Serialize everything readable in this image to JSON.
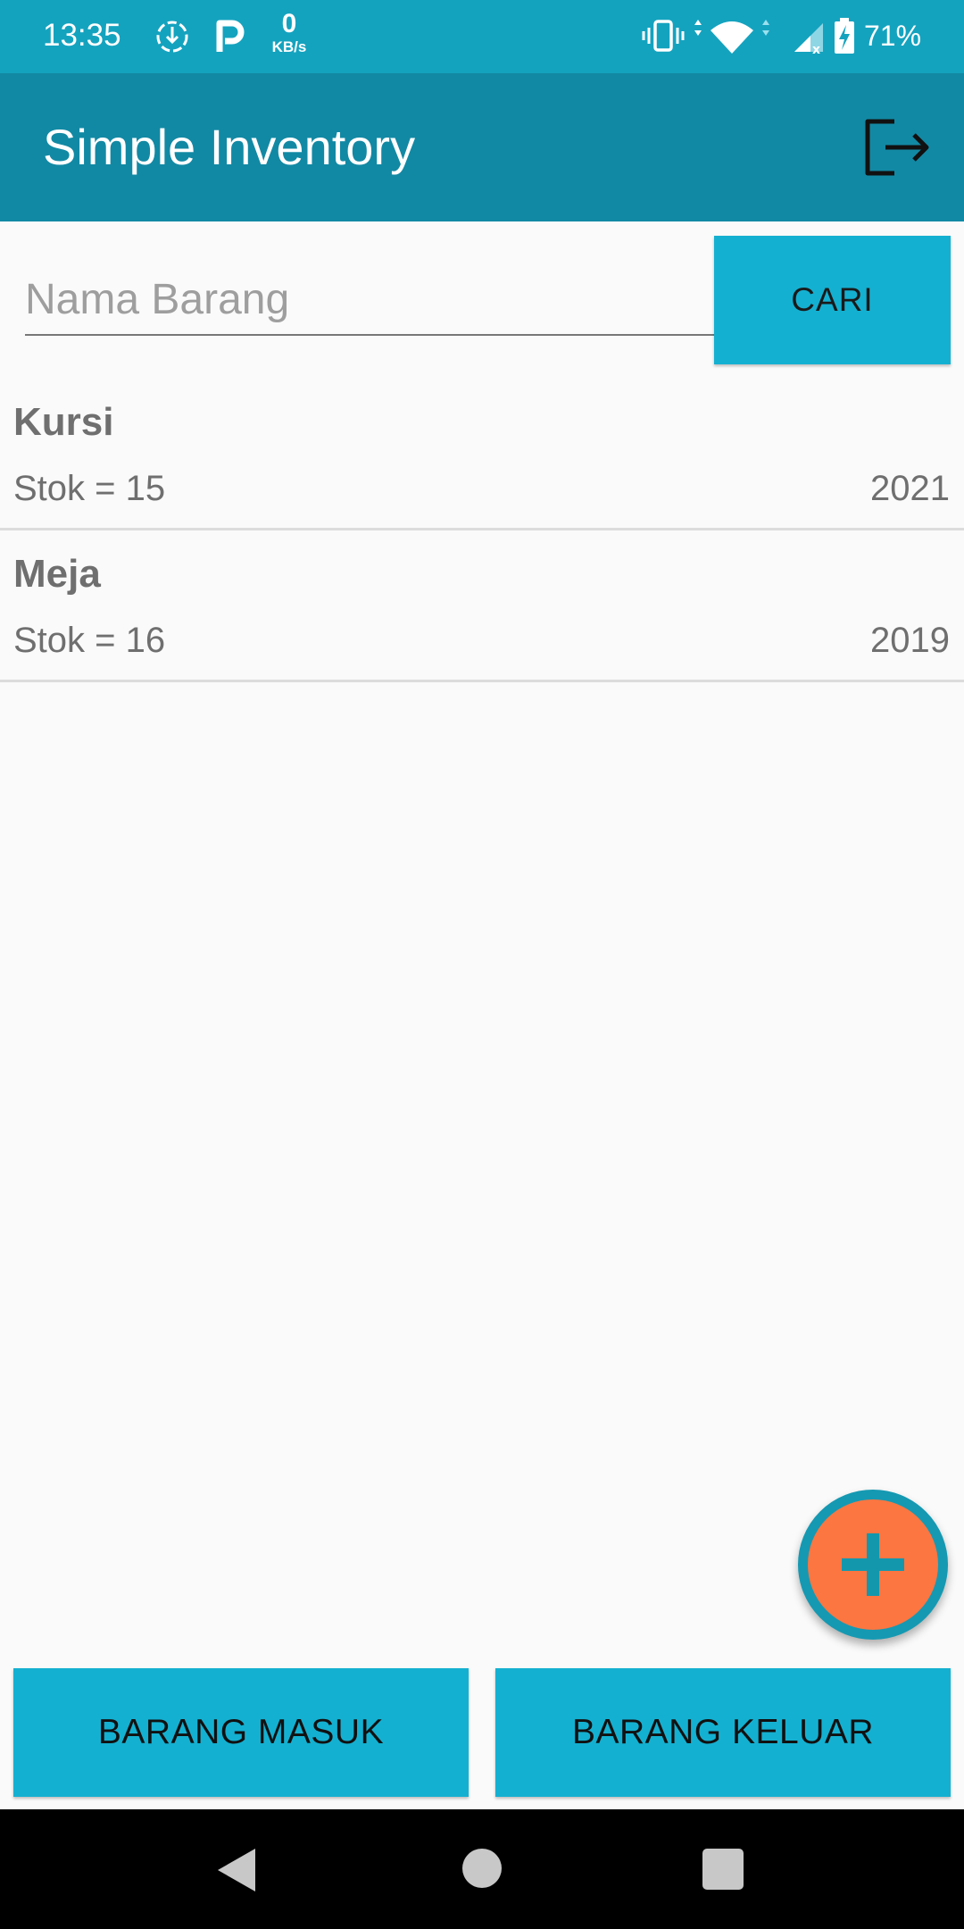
{
  "status_bar": {
    "time": "13:35",
    "net_speed_value": "0",
    "net_speed_unit": "KB/s",
    "battery_percent": "71%",
    "icons": [
      "download-icon",
      "parking-icon",
      "vibrate-icon",
      "wifi-icon",
      "signal-icon",
      "battery-icon"
    ]
  },
  "app_bar": {
    "title": "Simple Inventory",
    "logout_icon": "logout-icon"
  },
  "search": {
    "placeholder": "Nama Barang",
    "value": "",
    "button_label": "CARI"
  },
  "items": [
    {
      "name": "Kursi",
      "stock": "Stok = 15",
      "year": "2021"
    },
    {
      "name": "Meja",
      "stock": "Stok = 16",
      "year": "2019"
    }
  ],
  "fab": {
    "icon": "add-icon"
  },
  "bottom_actions": {
    "masuk_label": "BARANG MASUK",
    "keluar_label": "BARANG KELUAR"
  },
  "colors": {
    "status_bar": "#14a3bf",
    "app_bar": "#1289a4",
    "button": "#14b0d1",
    "fab": "#fb7641",
    "fab_ring": "#1599b2"
  },
  "nav_bar": {
    "icons": [
      "back-icon",
      "home-icon",
      "recent-apps-icon"
    ]
  }
}
